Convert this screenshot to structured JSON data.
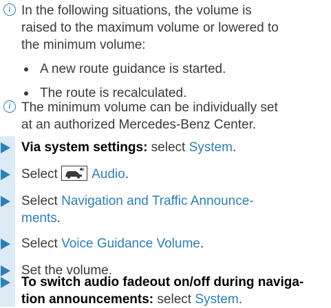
{
  "notes": [
    {
      "icon": "i",
      "lines": [
        "In the following situations, the volume is",
        "raised to the maximum volume or lowered to",
        "the minimum volume:"
      ]
    },
    {
      "icon": "i",
      "lines": [
        "The minimum volume can be individually set",
        "at an authorized Mercedes-Benz Center."
      ]
    }
  ],
  "bullets": [
    "A new route guidance is started.",
    "The route is recalculated."
  ],
  "steps": {
    "step1": {
      "bold": "Via system settings:",
      "text": " select ",
      "link": "System",
      "end": "."
    },
    "step2": {
      "text": "Select ",
      "icon_name": "car-audio-icon",
      "link": "Audio",
      "end": "."
    },
    "step3": {
      "text": "Select ",
      "link_line1": "Navigation and Traffic Announce-",
      "link_line2": "ments",
      "end": "."
    },
    "step4": {
      "text": "Select ",
      "link": "Voice Guidance Volume",
      "end": "."
    },
    "step5": {
      "text": "Set the volume."
    },
    "step6": {
      "bold_line1": "To switch audio fadeout on/off during naviga-",
      "bold_line2": "tion announcements:",
      "text": " select ",
      "link": "System",
      "end": "."
    }
  },
  "colors": {
    "accent": "#2e7fb5",
    "step_bar": "#dcebf5",
    "text": "#3a3a3a"
  }
}
